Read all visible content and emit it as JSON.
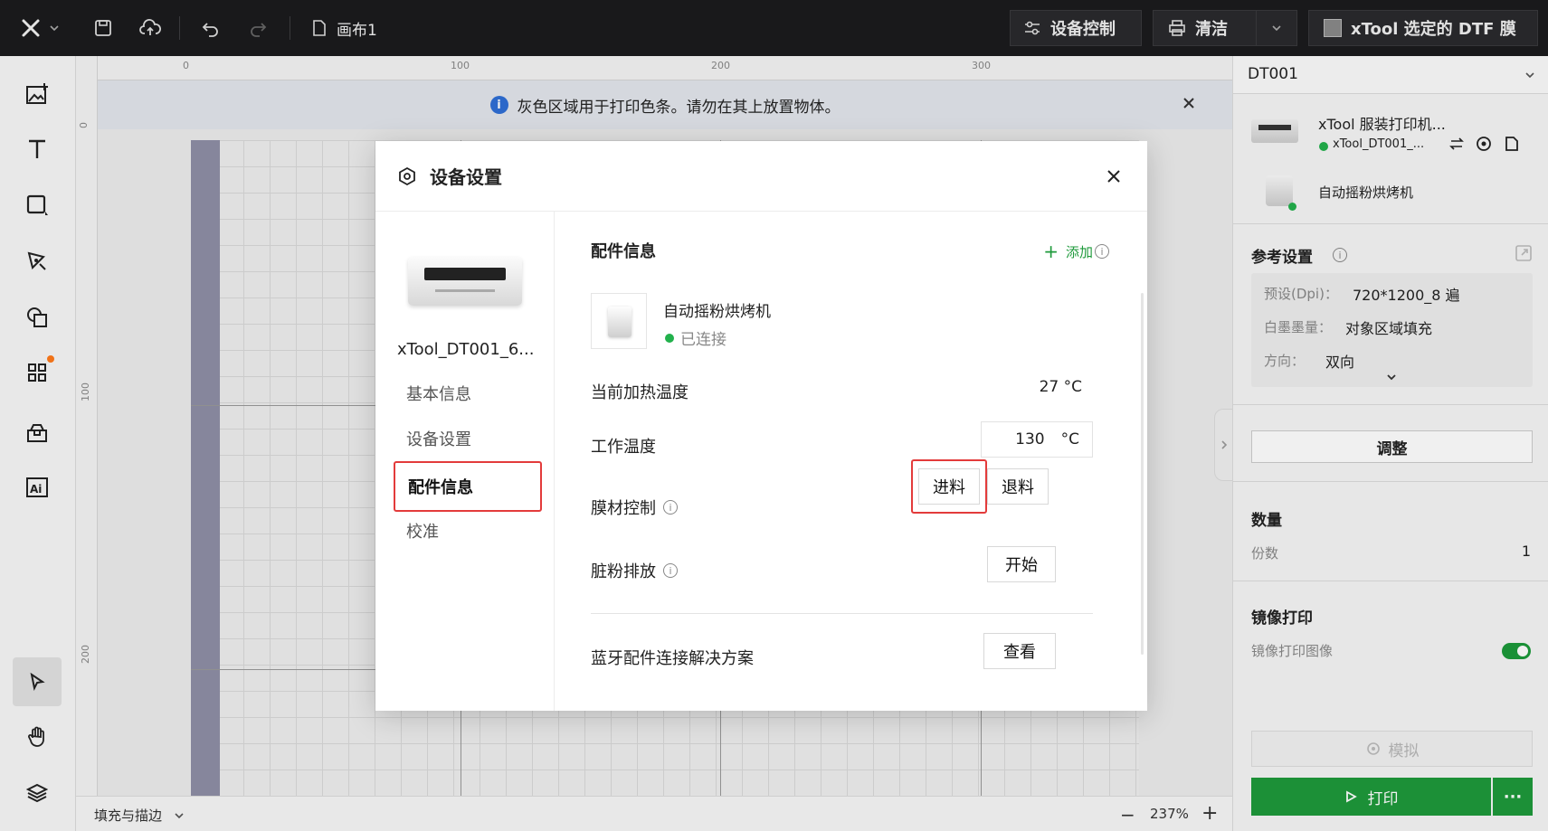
{
  "topbar": {
    "canvas_name": "画布1",
    "device_control": "设备控制",
    "clean": "清洁",
    "material": "xTool 选定的 DTF 膜"
  },
  "canvas": {
    "banner_text": "灰色区域用于打印色条。请勿在其上放置物体。",
    "ruler_top": [
      "0",
      "100",
      "200",
      "300"
    ],
    "ruler_left": [
      "0",
      "100",
      "200"
    ]
  },
  "bottombar": {
    "fill_stroke": "填充与描边",
    "zoom": "237%"
  },
  "right_panel": {
    "device_id": "DT001",
    "printer_name": "xTool 服装打印机...",
    "printer_conn": "xTool_DT001_...",
    "accessory_name": "自动摇粉烘烤机",
    "ref_settings_title": "参考设置",
    "preset_label": "预设(Dpi)：",
    "preset_value": "720*1200_8 遍",
    "white_ink_label": "白墨墨量：",
    "white_ink_value": "对象区域填充",
    "direction_label": "方向：",
    "direction_value": "双向",
    "adjust_btn": "调整",
    "quantity_title": "数量",
    "copies_label": "份数",
    "copies_value": "1",
    "mirror_title": "镜像打印",
    "mirror_label": "镜像打印图像",
    "simulate_btn": "模拟",
    "print_btn": "打印",
    "colors": {
      "print": "#1e9a3b",
      "toggle": "#1c9a3a",
      "online": "#22b14c"
    }
  },
  "modal": {
    "title": "设备设置",
    "device_name": "xTool_DT001_6...",
    "nav": [
      "基本信息",
      "设备设置",
      "配件信息",
      "校准"
    ],
    "active_nav": 2,
    "section_title": "配件信息",
    "add_label": "添加",
    "accessory_name": "自动摇粉烘烤机",
    "accessory_status": "已连接",
    "current_temp_label": "当前加热温度",
    "current_temp_value": "27 °C",
    "work_temp_label": "工作温度",
    "work_temp_value": "130",
    "work_temp_unit": "°C",
    "film_control_label": "膜材控制",
    "feed_btn": "进料",
    "retract_btn": "退料",
    "powder_label": "脏粉排放",
    "start_btn": "开始",
    "bt_label": "蓝牙配件连接解决方案",
    "view_btn": "查看",
    "colors": {
      "highlight": "#e33b3b",
      "add": "#1e9a3b",
      "connected": "#22b14c"
    }
  }
}
